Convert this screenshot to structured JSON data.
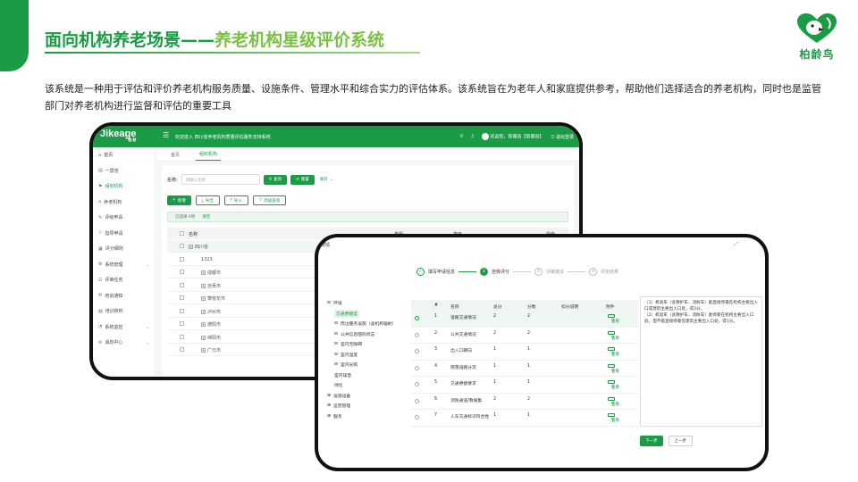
{
  "slide": {
    "title_main": "面向机构养老场景——",
    "title_sub": "养老机构星级评价系统",
    "logo_text": "柏龄鸟",
    "description": "该系统是一种用于评估和评价养老机构服务质量、设施条件、管理水平和综合实力的评估体系。该系统旨在为老年人和家庭提供参考，帮助他们选择适合的养老机构，同时也是监管部门对养老机构进行监督和评估的重要工具"
  },
  "back_app": {
    "logo": "Jikeage",
    "logo_sub": "柏 龄",
    "system_title": "欢迎进入 四川省养老机构质量评估服务支持系统",
    "welcome": "欢迎您，管理员【管理员】",
    "logout": "退出登录",
    "sidebar": [
      {
        "label": "首页",
        "active": false,
        "has_children": false
      },
      {
        "label": "一屏览",
        "active": false,
        "has_children": false
      },
      {
        "label": "组织机构",
        "active": true,
        "has_children": false
      },
      {
        "label": "养老机构",
        "active": false,
        "has_children": false
      },
      {
        "label": "评级申请",
        "active": false,
        "has_children": false
      },
      {
        "label": "指导申请",
        "active": false,
        "has_children": false
      },
      {
        "label": "评分细则",
        "active": false,
        "has_children": false
      },
      {
        "label": "系统管理",
        "active": false,
        "has_children": true
      },
      {
        "label": "评审任务",
        "active": false,
        "has_children": false
      },
      {
        "label": "培训通知",
        "active": false,
        "has_children": false
      },
      {
        "label": "培训资料",
        "active": false,
        "has_children": false
      },
      {
        "label": "系统监控",
        "active": false,
        "has_children": true
      },
      {
        "label": "消息中心",
        "active": false,
        "has_children": true
      }
    ],
    "tabs": [
      {
        "label": "首页",
        "active": false
      },
      {
        "label": "组织机构",
        "active": true
      }
    ],
    "search": {
      "label": "名称:",
      "placeholder": "请输入名称",
      "query_btn": "查询",
      "reset_btn": "重置",
      "expand_btn": "展开"
    },
    "toolbar": {
      "add": "新增",
      "export": "导出",
      "import": "导入",
      "advanced": "高级查询"
    },
    "selected": {
      "text": "已选择 0项",
      "clear": "清空"
    },
    "table": {
      "columns": [
        "名称",
        "类型",
        "排序",
        "操作"
      ],
      "rows": [
        {
          "name": "四川省",
          "expandable": true,
          "level": 0,
          "highlight": true
        },
        {
          "name": "1323",
          "expandable": false,
          "level": 1,
          "highlight": false
        },
        {
          "name": "成都市",
          "expandable": true,
          "level": 1,
          "highlight": false
        },
        {
          "name": "自贡市",
          "expandable": true,
          "level": 1,
          "highlight": false
        },
        {
          "name": "攀枝花市",
          "expandable": true,
          "level": 1,
          "highlight": false
        },
        {
          "name": "泸州市",
          "expandable": true,
          "level": 1,
          "highlight": false
        },
        {
          "name": "德阳市",
          "expandable": true,
          "level": 1,
          "highlight": false
        },
        {
          "name": "绵阳市",
          "expandable": true,
          "level": 1,
          "highlight": false
        },
        {
          "name": "广元市",
          "expandable": true,
          "level": 1,
          "highlight": false
        }
      ]
    }
  },
  "front_app": {
    "header": "详情",
    "steps": [
      {
        "num": "✓",
        "label": "填写申请信息",
        "state": "done"
      },
      {
        "num": "2",
        "label": "自我评分",
        "state": "current"
      },
      {
        "num": "3",
        "label": "评审建议",
        "state": "todo"
      },
      {
        "num": "4",
        "label": "评定结果",
        "state": "todo"
      }
    ],
    "tree": [
      {
        "label": "环境",
        "level": 0,
        "toggle": "⊟",
        "selected": false
      },
      {
        "label": "交通便捷度",
        "level": 1,
        "toggle": "",
        "selected": true
      },
      {
        "label": "周边服务设施（含机构辐射）",
        "level": 1,
        "toggle": "⊟",
        "selected": false
      },
      {
        "label": "公共信息图形标志",
        "level": 1,
        "toggle": "⊟",
        "selected": false
      },
      {
        "label": "室内无障碍",
        "level": 1,
        "toggle": "⊟",
        "selected": false
      },
      {
        "label": "室内温度",
        "level": 1,
        "toggle": "⊟",
        "selected": false
      },
      {
        "label": "室内光照",
        "level": 1,
        "toggle": "⊟",
        "selected": false
      },
      {
        "label": "室内噪音",
        "level": 1,
        "toggle": "",
        "selected": false
      },
      {
        "label": "绿化",
        "level": 1,
        "toggle": "",
        "selected": false
      },
      {
        "label": "设施设备",
        "level": 0,
        "toggle": "⊞",
        "selected": false
      },
      {
        "label": "运营管理",
        "level": 0,
        "toggle": "⊞",
        "selected": false
      },
      {
        "label": "服务",
        "level": 0,
        "toggle": "⊞",
        "selected": false
      }
    ],
    "table": {
      "columns": [
        "#",
        "名称",
        "总分",
        "分数",
        "扣分说明",
        "附件"
      ],
      "rows": [
        {
          "idx": "1",
          "name": "道路交通情况",
          "total": "2",
          "score": "2",
          "view": "查看",
          "highlight": true
        },
        {
          "idx": "2",
          "name": "公共交通情况",
          "total": "2",
          "score": "2",
          "view": "查看",
          "highlight": false
        },
        {
          "idx": "3",
          "name": "出入口朝向",
          "total": "1",
          "score": "1",
          "view": "查看",
          "highlight": false
        },
        {
          "idx": "4",
          "name": "院落道路分流",
          "total": "1",
          "score": "1",
          "view": "查看",
          "highlight": false
        },
        {
          "idx": "5",
          "name": "交通便捷要求",
          "total": "1",
          "score": "1",
          "view": "查看",
          "highlight": false
        },
        {
          "idx": "6",
          "name": "消防通道/救援集",
          "total": "2",
          "score": "2",
          "view": "查看",
          "highlight": false
        },
        {
          "idx": "7",
          "name": "人车交通标识符合性",
          "total": "1",
          "score": "1",
          "view": "查看",
          "highlight": false
        }
      ]
    },
    "note": [
      "（1）机动车（含救护车、消防车）能直接停靠在机构主要出入口或建筑主要出入口处，得2分。",
      "（2）机动车（含救护车、消防车）能停靠在机构主要出入口处，但不能直接停靠在建筑主要出入口处，得1分。"
    ],
    "next_btn": "下一步",
    "prev_btn": "上一步"
  },
  "colors": {
    "brand_green": "#1c9b46",
    "light_green": "#7bc043"
  }
}
